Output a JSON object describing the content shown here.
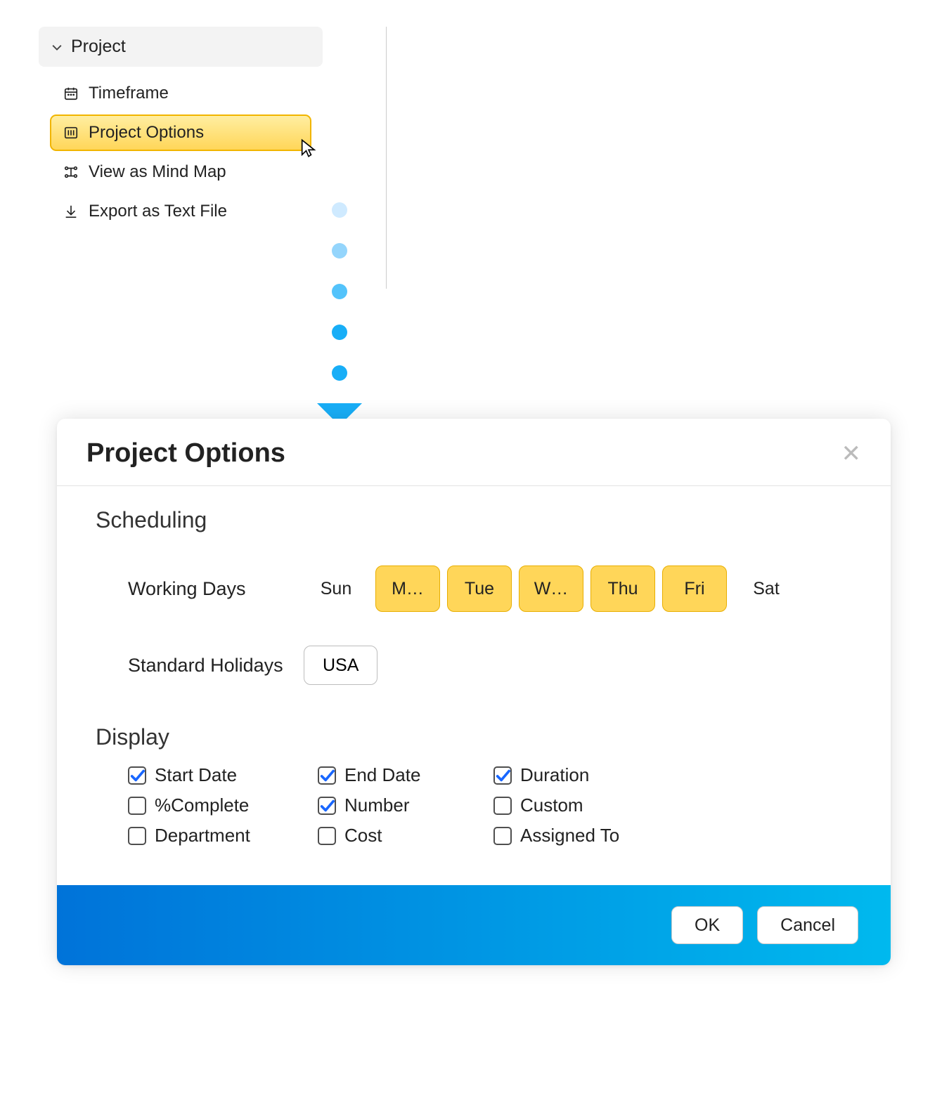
{
  "menu": {
    "header": "Project",
    "items": [
      {
        "label": "Timeframe",
        "active": false
      },
      {
        "label": "Project Options",
        "active": true
      },
      {
        "label": "View as Mind Map",
        "active": false
      },
      {
        "label": "Export as Text File",
        "active": false
      }
    ]
  },
  "dialog": {
    "title": "Project Options",
    "sections": {
      "scheduling": {
        "title": "Scheduling",
        "working_days_label": "Working Days",
        "standard_holidays_label": "Standard Holidays",
        "holiday_value": "USA",
        "days": [
          {
            "label": "Sun",
            "on": false
          },
          {
            "label": "M…",
            "on": true
          },
          {
            "label": "Tue",
            "on": true
          },
          {
            "label": "W…",
            "on": true
          },
          {
            "label": "Thu",
            "on": true
          },
          {
            "label": "Fri",
            "on": true
          },
          {
            "label": "Sat",
            "on": false
          }
        ]
      },
      "display": {
        "title": "Display",
        "checks": [
          {
            "label": "Start Date",
            "checked": true
          },
          {
            "label": "End Date",
            "checked": true
          },
          {
            "label": "Duration",
            "checked": true
          },
          {
            "label": "%Complete",
            "checked": false
          },
          {
            "label": "Number",
            "checked": true
          },
          {
            "label": "Custom",
            "checked": false
          },
          {
            "label": "Department",
            "checked": false
          },
          {
            "label": "Cost",
            "checked": false
          },
          {
            "label": "Assigned To",
            "checked": false
          }
        ]
      }
    },
    "buttons": {
      "ok": "OK",
      "cancel": "Cancel"
    }
  }
}
